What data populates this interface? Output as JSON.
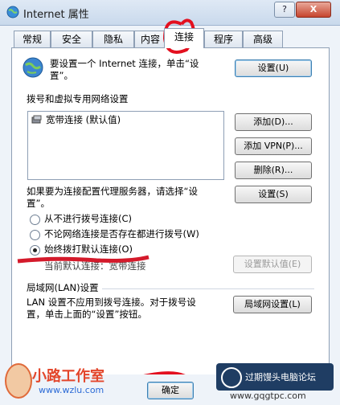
{
  "window": {
    "title": "Internet 属性",
    "help_label": "?",
    "close_label": "X"
  },
  "tabs": [
    {
      "label": "常规"
    },
    {
      "label": "安全"
    },
    {
      "label": "隐私"
    },
    {
      "label": "内容"
    },
    {
      "label": "连接",
      "active": true
    },
    {
      "label": "程序"
    },
    {
      "label": "高级"
    }
  ],
  "setup": {
    "text_line1": "要设置一个 Internet 连接，单击“设",
    "text_line2": "置”。",
    "button": "设置(U)"
  },
  "dialup": {
    "group_label": "拨号和虚拟专用网络设置",
    "connections": [
      {
        "label": "宽带连接 (默认值)"
      }
    ],
    "add_button": "添加(D)...",
    "add_vpn_button": "添加 VPN(P)...",
    "remove_button": "删除(R)...",
    "proxy_text_line1": "如果要为连接配置代理服务器，请选择“设",
    "proxy_text_line2": "置”。",
    "settings_button": "设置(S)",
    "options": [
      {
        "label": "从不进行拨号连接(C)",
        "checked": false
      },
      {
        "label": "不论网络连接是否存在都进行拨号(W)",
        "checked": false
      },
      {
        "label": "始终拨打默认连接(O)",
        "checked": true
      }
    ],
    "current_label": "当前默认连接：宽带连接",
    "set_default_button": "设置默认值(E)"
  },
  "lan": {
    "group_label": "局域网(LAN)设置",
    "text_line1": "LAN 设置不应用到拨号连接。对于拨号设",
    "text_line2": "置，单击上面的“设置”按钮。",
    "button": "局域网设置(L)"
  },
  "footer": {
    "ok_button": "确定"
  },
  "watermarks": {
    "left_brand": "小路工作室",
    "left_url": "www.wzlu.com",
    "right_text": "过期馒头电脑论坛",
    "right_url": "www.gqgtpc.com"
  }
}
